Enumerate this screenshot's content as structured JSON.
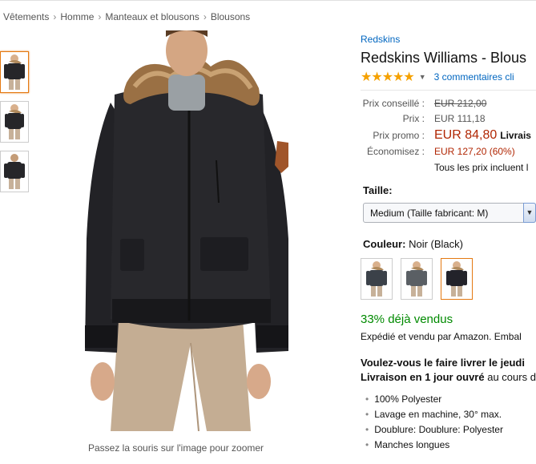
{
  "breadcrumbs": [
    "Vêtements",
    "Homme",
    "Manteaux et blousons",
    "Blousons"
  ],
  "image": {
    "zoom_caption": "Passez la souris sur l'image pour zoomer"
  },
  "product": {
    "brand": "Redskins",
    "title": "Redskins Williams - Blous",
    "rating_stars": 5,
    "reviews_link": "3 commentaires cli"
  },
  "prices": {
    "conseille_label": "Prix conseillé :",
    "conseille_value": "EUR 212,00",
    "prix_label": "Prix :",
    "prix_value": "EUR 111,18",
    "promo_label": "Prix promo :",
    "promo_value": "EUR 84,80",
    "promo_suffix": "Livrais",
    "economisez_label": "Économisez :",
    "economisez_value": "EUR 127,20 (60%)",
    "tax_note": "Tous les prix incluent l"
  },
  "size": {
    "label": "Taille:",
    "selected": "Medium (Taille fabricant: M)"
  },
  "color": {
    "label": "Couleur:",
    "selected": "Noir (Black)",
    "swatches": [
      "#3b4149",
      "#5a5f64",
      "#23232a"
    ]
  },
  "stock": {
    "sold": "33% déjà vendus",
    "shipped_by": "Expédié et vendu par Amazon. Embal"
  },
  "delivery": {
    "line1": "Voulez-vous le faire livrer le jeudi",
    "line2_bold": "Livraison en 1 jour ouvré",
    "line2_rest": " au cours d"
  },
  "features": [
    "100% Polyester",
    "Lavage en machine, 30° max.",
    "Doublure: Doublure: Polyester",
    "Manches longues"
  ],
  "colors": {
    "link": "#0066c0",
    "price_red": "#b12704",
    "green": "#008a00",
    "selected_border": "#e47911"
  }
}
